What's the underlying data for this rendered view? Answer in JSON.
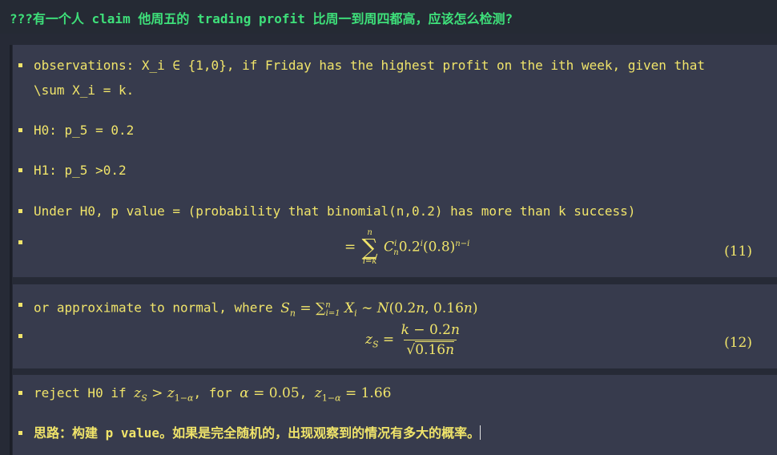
{
  "heading": {
    "text": "???有一个人 claim 他周五的 trading profit 比周一到周四都高，应该怎么检测?"
  },
  "items": {
    "observations_line1": "observations: X_i ∈ {1,0}, if Friday has the highest profit on the ith week, given that",
    "observations_line2": "\\sum X_i = k.",
    "h0": "H0: p_5 = 0.2",
    "h1": "H1: p_5 >0.2",
    "pvalue": "Under H0, p value = (probability that binomial(n,0.2) has more than k success)",
    "approx_prefix": "or approximate to normal, where",
    "reject_prefix": "reject H0 if",
    "reject_mid": ", for",
    "reject_sep": ",",
    "idea": "思路：构建 p value。如果是完全随机的，出现观察到的情况有多大的概率。"
  },
  "equations": {
    "eq11_number": "(11)",
    "eq12_number": "(12)"
  },
  "colors": {
    "text": "#f0e46a",
    "heading": "#3ee07a",
    "background": "#262a36",
    "block": "#373b4d"
  }
}
